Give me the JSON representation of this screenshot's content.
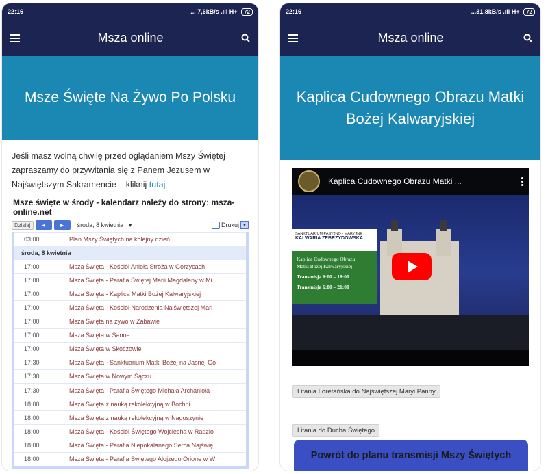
{
  "left": {
    "status": {
      "time": "22:16",
      "network": "... 7,6kB/s .ıll H+",
      "battery": "72"
    },
    "appbar": {
      "title": "Msza online"
    },
    "banner": {
      "title": "Msze Święte Na Żywo Po Polsku"
    },
    "intro": {
      "text": "Jeśli masz wolną chwilę przed oglądaniem Mszy Świętej zapraszamy do przywitania się z Panem Jezusem w Najświętszym Sakramencie – kliknij ",
      "link": "tutaj"
    },
    "calendar": {
      "title": "Msze święte w środy - kalendarz należy do strony: msza-online.net",
      "today": "Dzisiaj",
      "prev": "◄",
      "next": "►",
      "date": "środa, 8 kwietnia",
      "date_caret": "▼",
      "print": "Drukuj",
      "print_caret": "▼",
      "rows": [
        {
          "time": "03:00",
          "event": "Plan Mszy Świętych na kolejny dzień"
        },
        {
          "day": "środa, 8 kwietnia"
        },
        {
          "time": "17:00",
          "event": "Msza Święta - Kościół Anioła Stróża w Gorzycach"
        },
        {
          "time": "17:00",
          "event": "Msza Święta - Parafia Świętej Marii Magdaleny w Mi"
        },
        {
          "time": "17:00",
          "event": "Msza Święta - Kaplica Matki Bożej Kalwaryjskiej"
        },
        {
          "time": "17:00",
          "event": "Msza Święta - Kościół Narodzenia Najświętszej Mari"
        },
        {
          "time": "17:00",
          "event": "Msza Święta na żywo w Zabawie"
        },
        {
          "time": "17:00",
          "event": "Msza Święta w Sanoe"
        },
        {
          "time": "17:00",
          "event": "Msza Święta w Skoczowie"
        },
        {
          "time": "17:30",
          "event": "Msza Święta - Sanktuarium Matki Bożej na Jasnej Gó"
        },
        {
          "time": "17:30",
          "event": "Msza Święta w Nowym Sączu"
        },
        {
          "time": "17:30",
          "event": "Msza Święta - Parafia Świętego Michała Archanioła -"
        },
        {
          "time": "18:00",
          "event": "Msza Święta z nauką rekolekcyjną w Bochni"
        },
        {
          "time": "18:00",
          "event": "Msza Święta z nauką rekolekcyjną w Nagoszynie"
        },
        {
          "time": "18:00",
          "event": "Msza Święta - Kościół Świętego Wojciecha w Radzio"
        },
        {
          "time": "18:00",
          "event": "Msza Święta - Parafia Niepokalanego Serca Najświę"
        },
        {
          "time": "18:00",
          "event": "Msza Święta - Parafia Świętego Alojzego Orione w W"
        }
      ]
    }
  },
  "right": {
    "status": {
      "time": "22:16",
      "network": "...31,8kB/s .ıll H+",
      "battery": "72"
    },
    "appbar": {
      "title": "Msza online"
    },
    "banner": {
      "title": "Kaplica Cudownego Obrazu Matki Bożej Kalwaryjskiej"
    },
    "video": {
      "title": "Kaplica Cudownego Obrazu Matki ...",
      "sanctuary_line": "SANKTUARIUM PASYJNO - MARYJNE",
      "sanctuary_name": "KALWARIA ZEBRZYDOWSKA",
      "panel_line1": "Kaplica Cudownego Obrazu",
      "panel_line2": "Matki Bożej Kalwaryjskiej",
      "panel_line3": "Transmisja 6:00 – 18:00",
      "panel_line4": "Transmisja 6:00 – 21:00"
    },
    "chip1": "Litania Loretańska do Najświętszej Maryi Panny",
    "chip2": "Litania do Ducha Świętego",
    "back_button": "Powrót do planu transmisji Mszy Świętych"
  }
}
